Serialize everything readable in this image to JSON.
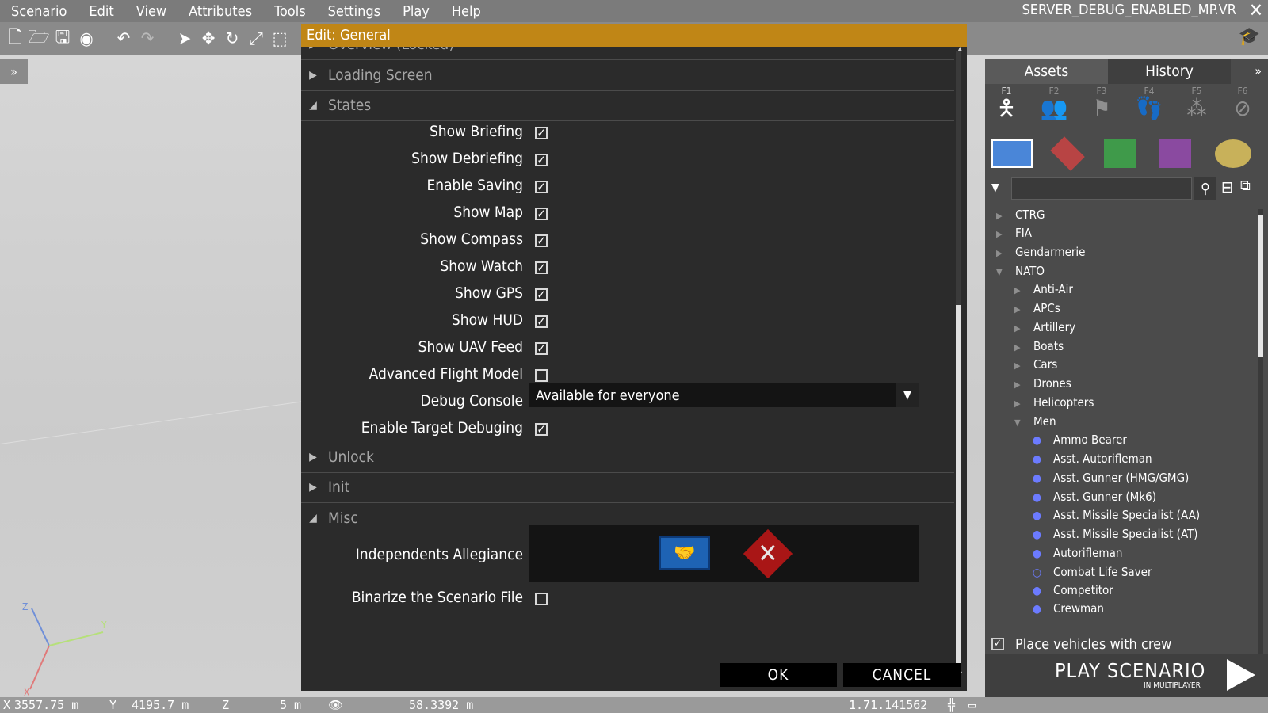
{
  "menubar": {
    "items": [
      "Scenario",
      "Edit",
      "View",
      "Attributes",
      "Tools",
      "Settings",
      "Play",
      "Help"
    ],
    "mission_name": "SERVER_DEBUG_ENABLED_MP.VR"
  },
  "icons": {
    "close": "close-icon",
    "new": "new-file-icon",
    "open": "open-folder-icon",
    "save": "save-icon",
    "steam": "steam-icon",
    "undo": "undo-icon",
    "redo": "redo-icon",
    "select": "select-cursor-icon",
    "move": "move-icon",
    "rotate": "rotate-icon",
    "scale": "scale-icon",
    "area": "area-select-icon"
  },
  "dialog": {
    "title": "Edit: General",
    "sections": {
      "overview": "Overview (Locked)",
      "loading": "Loading Screen",
      "states": "States",
      "unlock": "Unlock",
      "init": "Init",
      "misc": "Misc"
    },
    "states": [
      {
        "label": "Show Briefing",
        "checked": true
      },
      {
        "label": "Show Debriefing",
        "checked": true
      },
      {
        "label": "Enable Saving",
        "checked": true
      },
      {
        "label": "Show Map",
        "checked": true
      },
      {
        "label": "Show Compass",
        "checked": true
      },
      {
        "label": "Show Watch",
        "checked": true
      },
      {
        "label": "Show GPS",
        "checked": true
      },
      {
        "label": "Show HUD",
        "checked": true
      },
      {
        "label": "Show UAV Feed",
        "checked": true
      },
      {
        "label": "Advanced Flight Model",
        "checked": false
      }
    ],
    "debug_console": {
      "label": "Debug Console",
      "value": "Available for everyone"
    },
    "target_debug": {
      "label": "Enable Target Debuging",
      "checked": true
    },
    "misc": {
      "allegiance_label": "Independents Allegiance",
      "binarize_label": "Binarize the Scenario File",
      "binarize_checked": false
    },
    "buttons": {
      "ok": "OK",
      "cancel": "CANCEL"
    }
  },
  "right_panel": {
    "tabs": [
      "Assets",
      "History"
    ],
    "fkeys": [
      "F1",
      "F2",
      "F3",
      "F4",
      "F5",
      "F6"
    ],
    "side_colors": [
      "#4a86d8",
      "#b84444",
      "#3f9a4a",
      "#8a4aa0",
      "#c8b15a"
    ],
    "tree": [
      {
        "label": "CTRG",
        "level": 0,
        "open": false
      },
      {
        "label": "FIA",
        "level": 0,
        "open": false
      },
      {
        "label": "Gendarmerie",
        "level": 0,
        "open": false
      },
      {
        "label": "NATO",
        "level": 0,
        "open": true
      },
      {
        "label": "Anti-Air",
        "level": 1,
        "open": false
      },
      {
        "label": "APCs",
        "level": 1,
        "open": false
      },
      {
        "label": "Artillery",
        "level": 1,
        "open": false
      },
      {
        "label": "Boats",
        "level": 1,
        "open": false
      },
      {
        "label": "Cars",
        "level": 1,
        "open": false
      },
      {
        "label": "Drones",
        "level": 1,
        "open": false
      },
      {
        "label": "Helicopters",
        "level": 1,
        "open": false
      },
      {
        "label": "Men",
        "level": 1,
        "open": true
      },
      {
        "label": "Ammo Bearer",
        "level": 2
      },
      {
        "label": "Asst. Autorifleman",
        "level": 2
      },
      {
        "label": "Asst. Gunner (HMG/GMG)",
        "level": 2
      },
      {
        "label": "Asst. Gunner (Mk6)",
        "level": 2
      },
      {
        "label": "Asst. Missile Specialist (AA)",
        "level": 2
      },
      {
        "label": "Asst. Missile Specialist (AT)",
        "level": 2
      },
      {
        "label": "Autorifleman",
        "level": 2
      },
      {
        "label": "Combat Life Saver",
        "level": 2
      },
      {
        "label": "Competitor",
        "level": 2
      },
      {
        "label": "Crewman",
        "level": 2
      }
    ],
    "place_vehicles": {
      "label": "Place vehicles with crew",
      "checked": true
    },
    "play": {
      "title": "PLAY SCENARIO",
      "subtitle": "IN MULTIPLAYER"
    }
  },
  "statusbar": {
    "x_label": "X",
    "x_value": "3557.75 m",
    "y_label": "Y",
    "y_value": "4195.7 m",
    "z_label": "Z",
    "z_value": "5 m",
    "view_value": "58.3392 m",
    "version": "1.71.141562"
  },
  "gizmo": {
    "x": "X",
    "y": "Y",
    "z": "Z"
  }
}
